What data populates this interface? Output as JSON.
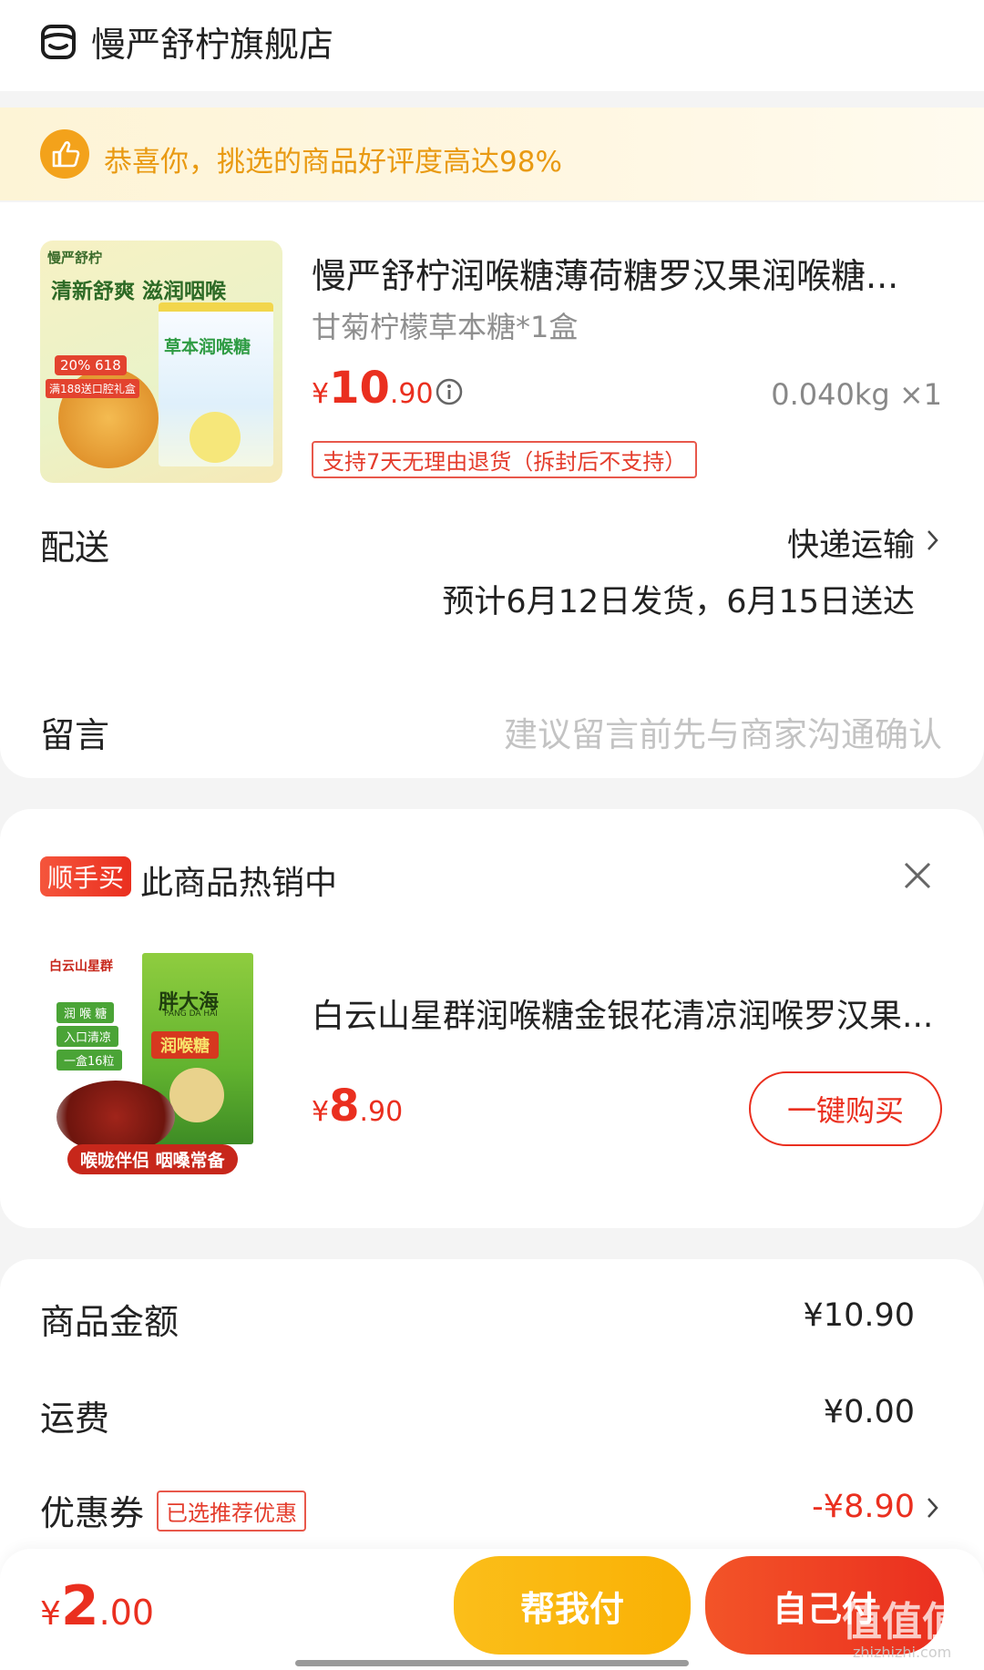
{
  "header": {
    "store_name": "慢严舒柠旗舰店",
    "store_icon": "store-icon"
  },
  "banner": {
    "icon": "thumbs-up-icon",
    "text": "恭喜你，挑选的商品好评度高达98%"
  },
  "product": {
    "title": "慢严舒柠润喉糖薄荷糖罗汉果润喉糖...",
    "spec": "甘菊柠檬草本糖*1盒",
    "currency": "¥",
    "price_int": "10",
    "price_dec": ".90",
    "weight_qty": "0.040kg ×1",
    "return_policy": "支持7天无理由退货（拆封后不支持）",
    "image": {
      "brand": "慢严舒柠",
      "slogan": "清新舒爽 滋润咽喉",
      "box_label": "草本润喉糖",
      "promo": "20% 618",
      "gift": "满188送口腔礼盒"
    }
  },
  "delivery": {
    "label": "配送",
    "method": "快递运输",
    "estimate": "预计6月12日发货，6月15日送达"
  },
  "message": {
    "label": "留言",
    "placeholder": "建议留言前先与商家沟通确认"
  },
  "upsell": {
    "badge": "顺手买",
    "title": "此商品热销中",
    "close_icon": "close-icon",
    "product_title": "白云山星群润喉糖金银花清凉润喉罗汉果...",
    "currency": "¥",
    "price_int": "8",
    "price_dec": ".90",
    "buy_button": "一键购买",
    "image": {
      "brand": "白云山星群",
      "box_name": "胖大海",
      "box_sub": "PANG DA HAI",
      "box_label": "润喉糖",
      "tags": [
        "润 喉 糖",
        "入口清凉",
        "一盒16粒"
      ],
      "footer": "喉咙伴侣 咽嗓常备"
    }
  },
  "summary": {
    "rows": [
      {
        "label": "商品金额",
        "value": "¥10.90"
      },
      {
        "label": "运费",
        "value": "¥0.00"
      },
      {
        "label": "优惠券",
        "tag": "已选推荐优惠",
        "value": "-¥8.90"
      }
    ]
  },
  "footer": {
    "currency": "¥",
    "total_int": "2",
    "total_dec": ".00",
    "help_pay": "帮我付",
    "self_pay": "自己付",
    "watermark": "值值值",
    "watermark_url": "zhizhizhi.com"
  },
  "colors": {
    "accent_red": "#ea2f1f",
    "banner_orange": "#f3a21b",
    "help_yellow": "#fbb30c",
    "self_red": "#f03a1d"
  }
}
